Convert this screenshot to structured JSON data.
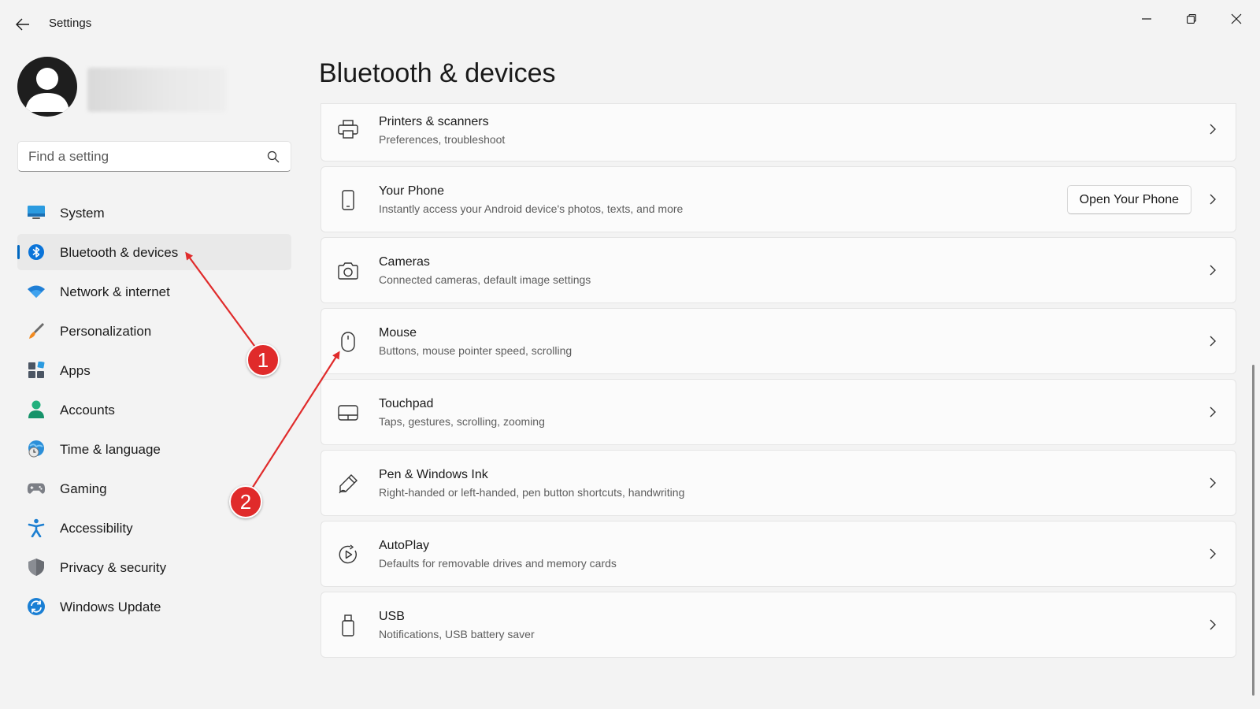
{
  "window": {
    "title": "Settings"
  },
  "search": {
    "placeholder": "Find a setting"
  },
  "nav": {
    "items": [
      {
        "label": "System",
        "icon": "monitor-icon"
      },
      {
        "label": "Bluetooth & devices",
        "icon": "bluetooth-icon",
        "active": true
      },
      {
        "label": "Network & internet",
        "icon": "wifi-icon"
      },
      {
        "label": "Personalization",
        "icon": "brush-icon"
      },
      {
        "label": "Apps",
        "icon": "apps-icon"
      },
      {
        "label": "Accounts",
        "icon": "person-icon"
      },
      {
        "label": "Time & language",
        "icon": "globe-clock-icon"
      },
      {
        "label": "Gaming",
        "icon": "gamepad-icon"
      },
      {
        "label": "Accessibility",
        "icon": "accessibility-icon"
      },
      {
        "label": "Privacy & security",
        "icon": "shield-icon"
      },
      {
        "label": "Windows Update",
        "icon": "update-icon"
      }
    ]
  },
  "main": {
    "title": "Bluetooth & devices",
    "cards": [
      {
        "title": "Printers & scanners",
        "subtitle": "Preferences, troubleshoot",
        "icon": "printer-icon"
      },
      {
        "title": "Your Phone",
        "subtitle": "Instantly access your Android device's photos, texts, and more",
        "icon": "phone-icon",
        "button": "Open Your Phone"
      },
      {
        "title": "Cameras",
        "subtitle": "Connected cameras, default image settings",
        "icon": "camera-icon"
      },
      {
        "title": "Mouse",
        "subtitle": "Buttons, mouse pointer speed, scrolling",
        "icon": "mouse-icon"
      },
      {
        "title": "Touchpad",
        "subtitle": "Taps, gestures, scrolling, zooming",
        "icon": "touchpad-icon"
      },
      {
        "title": "Pen & Windows Ink",
        "subtitle": "Right-handed or left-handed, pen button shortcuts, handwriting",
        "icon": "pen-icon"
      },
      {
        "title": "AutoPlay",
        "subtitle": "Defaults for removable drives and memory cards",
        "icon": "autoplay-icon"
      },
      {
        "title": "USB",
        "subtitle": "Notifications, USB battery saver",
        "icon": "usb-icon"
      }
    ]
  },
  "annotations": {
    "badge_1": "1",
    "badge_2": "2",
    "color": "#e02b2b"
  },
  "colors": {
    "accent": "#0067c0",
    "background": "#f3f3f3",
    "card": "#fbfbfb"
  }
}
